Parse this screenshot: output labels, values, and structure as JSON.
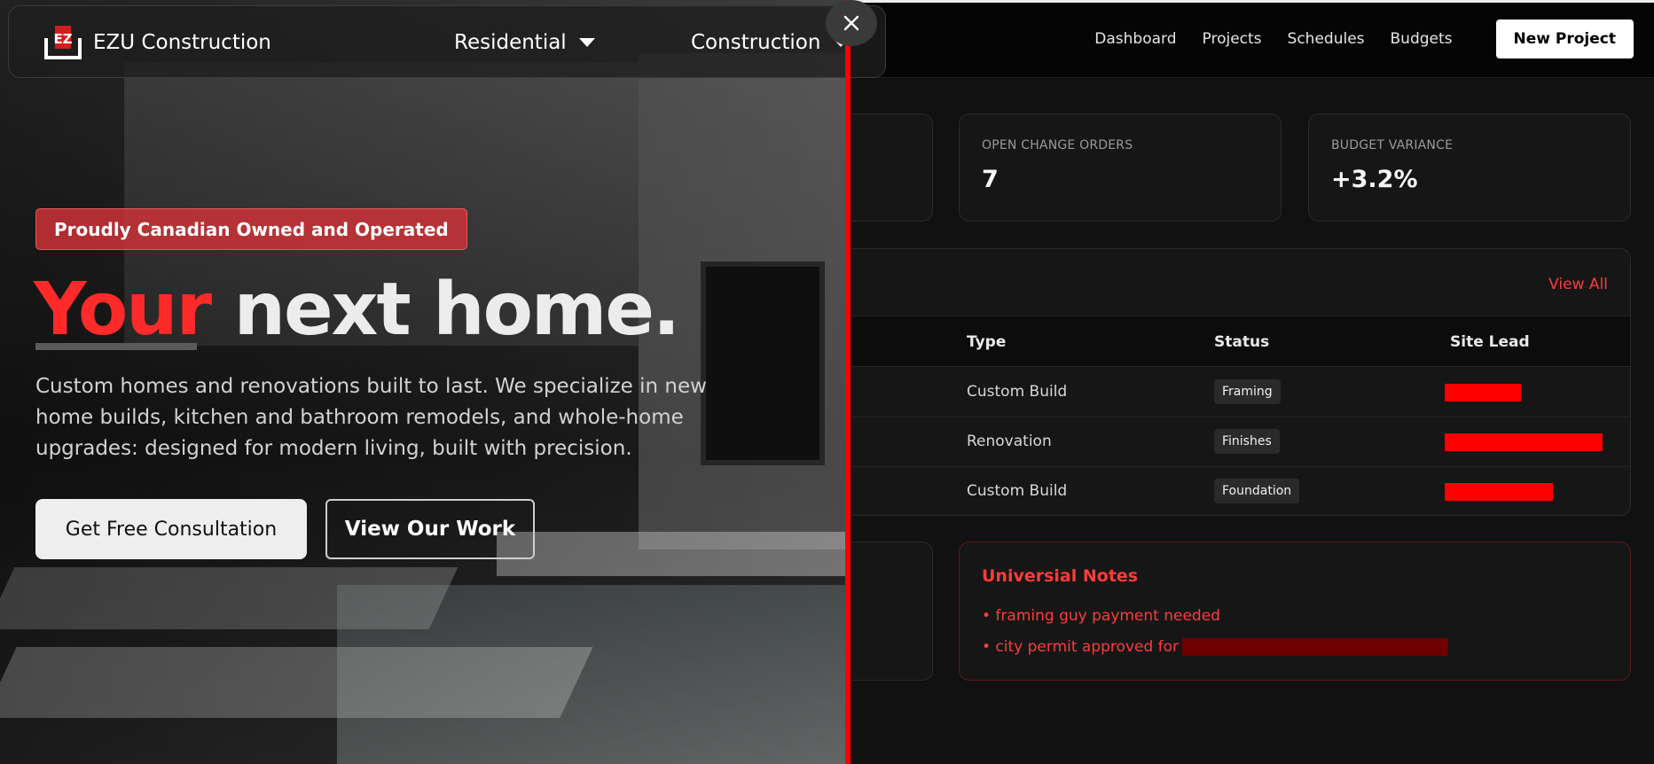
{
  "hero": {
    "brand": "EZU Construction",
    "logo_letters": "EZ",
    "nav": [
      {
        "label": "Residential"
      },
      {
        "label": "Construction"
      }
    ],
    "tagline": "Proudly Canadian Owned and Operated",
    "headline_accent": "Your",
    "headline_rest": " next home.",
    "description": "Custom homes and renovations built to last. We specialize in new home builds, kitchen and bathroom remodels, and whole-home upgrades: designed for modern living, built with precision.",
    "cta_primary": "Get Free Consultation",
    "cta_secondary": "View Our Work"
  },
  "dashboard": {
    "nav": [
      "Dashboard",
      "Projects",
      "Schedules",
      "Budgets"
    ],
    "new_project": "New Project",
    "stats": [
      {
        "label": "OPEN CHANGE ORDERS",
        "value": "7"
      },
      {
        "label": "BUDGET VARIANCE",
        "value": "+3.2%"
      }
    ],
    "table": {
      "view_all": "View All",
      "columns": [
        "Type",
        "Status",
        "Site Lead"
      ],
      "rows": [
        {
          "type": "Custom Build",
          "status": "Framing"
        },
        {
          "type": "Renovation",
          "status": "Finishes"
        },
        {
          "type": "Custom Build",
          "status": "Foundation"
        }
      ]
    },
    "notes": {
      "title": "Universial Notes",
      "items": [
        "• framing guy payment needed",
        "• city permit approved for"
      ]
    }
  },
  "colors": {
    "accent": "#ff2a2a",
    "divider": "#ff0000",
    "redaction": "#ff0000"
  }
}
